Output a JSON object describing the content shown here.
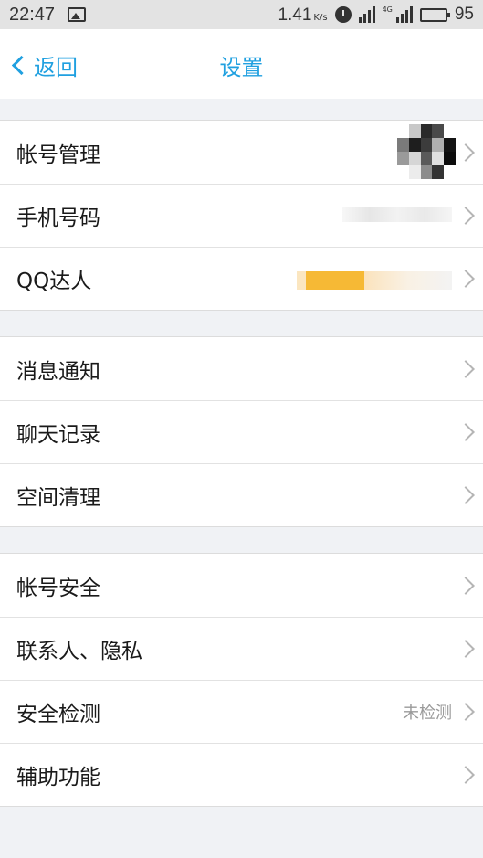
{
  "status_bar": {
    "time": "22:47",
    "net_speed": "1.41",
    "net_speed_unit": "K/s",
    "network_type": "4G",
    "battery_level": "95",
    "icons": [
      "image-notification-icon",
      "alarm-icon",
      "signal-icon",
      "signal-4g-icon",
      "battery-icon"
    ]
  },
  "nav": {
    "back_label": "返回",
    "title": "设置"
  },
  "groups": [
    {
      "items": [
        {
          "label": "帐号管理"
        },
        {
          "label": "手机号码"
        },
        {
          "label": "QQ达人"
        }
      ]
    },
    {
      "items": [
        {
          "label": "消息通知"
        },
        {
          "label": "聊天记录"
        },
        {
          "label": "空间清理"
        }
      ]
    },
    {
      "items": [
        {
          "label": "帐号安全"
        },
        {
          "label": "联系人、隐私"
        },
        {
          "label": "安全检测",
          "value": "未检测"
        },
        {
          "label": "辅助功能"
        }
      ]
    }
  ],
  "colors": {
    "accent": "#20a0e0",
    "background": "#f0f2f5",
    "row_background": "#ffffff",
    "secondary_text": "#9a9a9a"
  }
}
